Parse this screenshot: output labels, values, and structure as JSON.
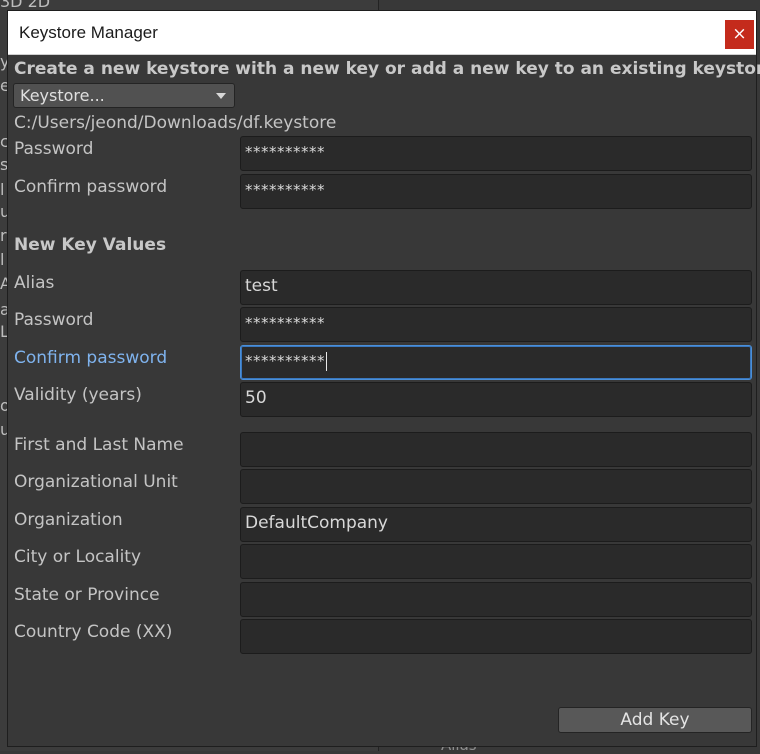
{
  "background": {
    "left_fragments": [
      "3D 2D",
      "r",
      "t",
      "y",
      "e",
      "c",
      "s",
      "l",
      "u",
      "r",
      "l",
      "A",
      "a",
      "L",
      "o",
      "u"
    ],
    "bottom_label": "Alias"
  },
  "window": {
    "title": "Keystore Manager",
    "close_glyph": "×"
  },
  "header": {
    "subtitle": "Create a new keystore with a new key or add a new key to an existing keystore",
    "keystore_dropdown": "Keystore...",
    "path": "C:/Users/jeond/Downloads/df.keystore"
  },
  "keystore": {
    "password_label": "Password",
    "password_value": "**********",
    "confirm_label": "Confirm password",
    "confirm_value": "**********"
  },
  "new_key": {
    "section_title": "New Key Values",
    "alias_label": "Alias",
    "alias_value": "test",
    "password_label": "Password",
    "password_value": "**********",
    "confirm_label": "Confirm password",
    "confirm_value": "**********",
    "validity_label": "Validity (years)",
    "validity_value": "50",
    "name_label": "First and Last Name",
    "name_value": "",
    "unit_label": "Organizational Unit",
    "unit_value": "",
    "org_label": "Organization",
    "org_value": "DefaultCompany",
    "city_label": "City or Locality",
    "city_value": "",
    "state_label": "State or Province",
    "state_value": "",
    "country_label": "Country Code (XX)",
    "country_value": ""
  },
  "actions": {
    "add_key": "Add Key"
  },
  "colors": {
    "close_button": "#c42b1c",
    "focus_accent": "#4a8fd9",
    "active_label": "#7fb3ee"
  }
}
